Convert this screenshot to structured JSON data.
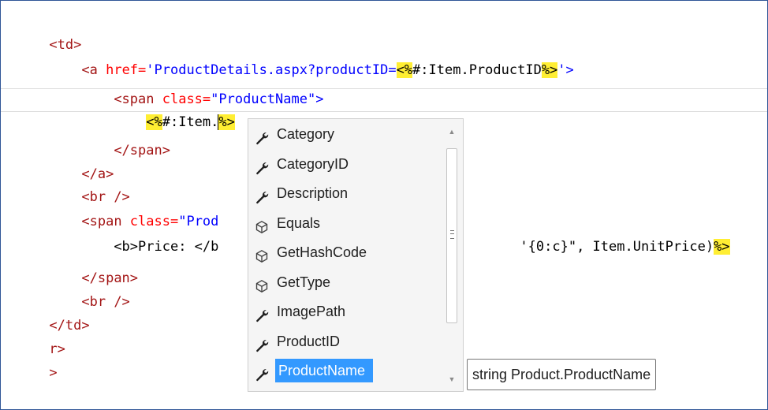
{
  "editor": {
    "lines": [
      {
        "i1": "",
        "t": "<td>"
      },
      {
        "i1": "    ",
        "a_open": "<a ",
        "href_attr": "href=",
        "href_val": "'ProductDetails.aspx?productID=",
        "expr_open": "<%",
        "expr_body": "#:Item.ProductID",
        "expr_close": "%>",
        "href_end": "'>"
      },
      {
        "i1": "        ",
        "span_open": "<span ",
        "cls_attr": "class=",
        "cls_val": "\"ProductName\"",
        "gt": ">"
      },
      {
        "i1": "            ",
        "expr_open": "<%",
        "expr_body": "#:Item.",
        "expr_close": "%>"
      },
      {
        "i1": "        ",
        "t": "</span>"
      },
      {
        "i1": "    ",
        "t": "</a>"
      },
      {
        "i1": "    ",
        "t": "<br />"
      },
      {
        "i1": "    ",
        "span_open": "<span ",
        "cls_attr": "class=",
        "cls_val": "\"Prod"
      },
      {
        "i1": "        ",
        "b_text": "<b>Price: </b",
        "tail_val": "'{0:c}\", Item.UnitPrice)",
        "expr_close": "%>"
      },
      {
        "i1": "    ",
        "t": "</span>"
      },
      {
        "i1": "    ",
        "t": "<br />"
      },
      {
        "i1": "",
        "t": "</td>"
      },
      {
        "i1": "",
        "t": "r>"
      },
      {
        "i1": "",
        "t": ">"
      }
    ]
  },
  "completion": {
    "items": [
      {
        "label": "Category",
        "icon": "wrench-property-icon"
      },
      {
        "label": "CategoryID",
        "icon": "wrench-property-icon"
      },
      {
        "label": "Description",
        "icon": "wrench-property-icon"
      },
      {
        "label": "Equals",
        "icon": "cube-method-icon"
      },
      {
        "label": "GetHashCode",
        "icon": "cube-method-icon"
      },
      {
        "label": "GetType",
        "icon": "cube-method-icon"
      },
      {
        "label": "ImagePath",
        "icon": "wrench-property-icon"
      },
      {
        "label": "ProductID",
        "icon": "wrench-property-icon"
      },
      {
        "label": "ProductName",
        "icon": "wrench-property-icon",
        "selected": true
      }
    ]
  },
  "tooltip": {
    "text": "string Product.ProductName"
  }
}
